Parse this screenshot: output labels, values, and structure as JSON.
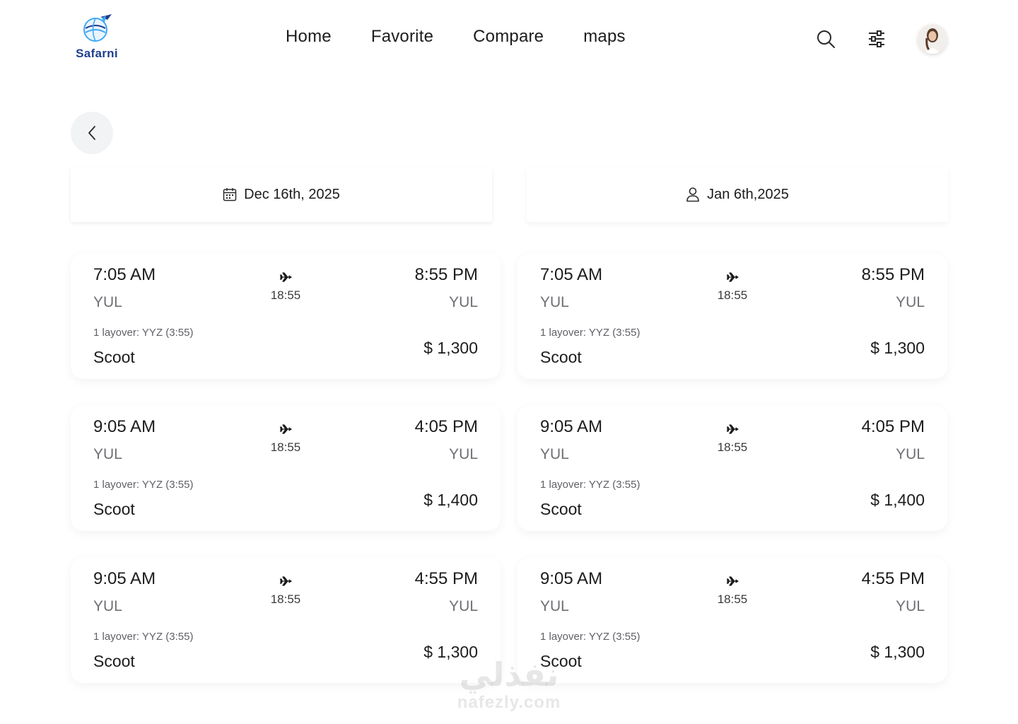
{
  "brand": {
    "name": "Safarni",
    "primary_color": "#1f3f8f",
    "accent_color": "#3fa9f5"
  },
  "nav": {
    "items": [
      {
        "label": "Home"
      },
      {
        "label": "Favorite"
      },
      {
        "label": "Compare"
      },
      {
        "label": "maps"
      }
    ]
  },
  "header_icons": {
    "search": "search-icon",
    "filter": "sliders-icon",
    "avatar": "user-avatar"
  },
  "back": {
    "icon": "chevron-left-icon"
  },
  "date_tabs": {
    "departure": {
      "label": "Dec 16th, 2025",
      "icon": "calendar-icon"
    },
    "return": {
      "label": "Jan 6th,2025",
      "icon": "person-icon"
    }
  },
  "flights": {
    "left": [
      {
        "dep_time": "7:05 AM",
        "dep_code": "YUL",
        "arr_time": "8:55 PM",
        "arr_code": "YUL",
        "duration": "18:55",
        "layover": "1 layover: YYZ (3:55)",
        "airline": "Scoot",
        "price": "$ 1,300"
      },
      {
        "dep_time": "9:05 AM",
        "dep_code": "YUL",
        "arr_time": "4:05 PM",
        "arr_code": "YUL",
        "duration": "18:55",
        "layover": "1 layover: YYZ (3:55)",
        "airline": "Scoot",
        "price": "$ 1,400"
      },
      {
        "dep_time": "9:05 AM",
        "dep_code": "YUL",
        "arr_time": "4:55 PM",
        "arr_code": "YUL",
        "duration": "18:55",
        "layover": "1 layover: YYZ (3:55)",
        "airline": "Scoot",
        "price": "$ 1,300"
      }
    ],
    "right": [
      {
        "dep_time": "7:05 AM",
        "dep_code": "YUL",
        "arr_time": "8:55 PM",
        "arr_code": "YUL",
        "duration": "18:55",
        "layover": "1 layover: YYZ (3:55)",
        "airline": "Scoot",
        "price": "$ 1,300"
      },
      {
        "dep_time": "9:05 AM",
        "dep_code": "YUL",
        "arr_time": "4:05 PM",
        "arr_code": "YUL",
        "duration": "18:55",
        "layover": "1 layover: YYZ (3:55)",
        "airline": "Scoot",
        "price": "$ 1,400"
      },
      {
        "dep_time": "9:05 AM",
        "dep_code": "YUL",
        "arr_time": "4:55 PM",
        "arr_code": "YUL",
        "duration": "18:55",
        "layover": "1 layover: YYZ (3:55)",
        "airline": "Scoot",
        "price": "$ 1,300"
      }
    ]
  },
  "watermark": {
    "arabic": "نفذلي",
    "latin": "nafezly.com"
  }
}
